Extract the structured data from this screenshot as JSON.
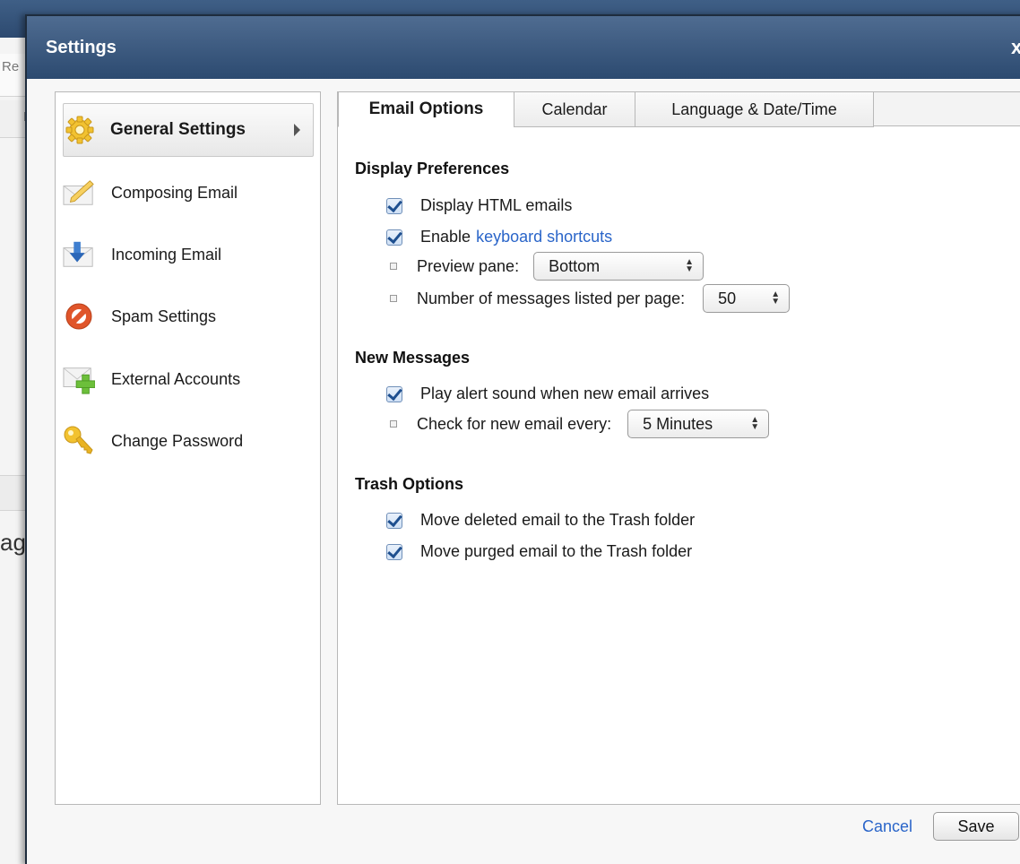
{
  "background": {
    "row1_text": "Re",
    "row2_text": "F",
    "row4_text": "ag"
  },
  "modal": {
    "title": "Settings",
    "close_label": "x"
  },
  "sidebar": {
    "items": [
      {
        "label": "General Settings",
        "icon": "gear-icon"
      },
      {
        "label": "Composing Email",
        "icon": "pencil-icon"
      },
      {
        "label": "Incoming Email",
        "icon": "download-arrow-icon"
      },
      {
        "label": "Spam Settings",
        "icon": "prohibited-icon"
      },
      {
        "label": "External Accounts",
        "icon": "envelope-plus-icon"
      },
      {
        "label": "Change Password",
        "icon": "key-icon"
      }
    ]
  },
  "tabs": [
    {
      "label": "Email Options"
    },
    {
      "label": "Calendar"
    },
    {
      "label": "Language & Date/Time"
    }
  ],
  "display_preferences": {
    "title": "Display Preferences",
    "display_html": "Display HTML emails",
    "enable_prefix": "Enable",
    "keyboard_shortcuts_link": "keyboard shortcuts",
    "preview_pane_label": "Preview pane:",
    "preview_pane_value": "Bottom",
    "messages_per_page_label": "Number of messages listed per page:",
    "messages_per_page_value": "50"
  },
  "new_messages": {
    "title": "New Messages",
    "play_alert": "Play alert sound when new email arrives",
    "check_label": "Check for new email every:",
    "check_value": "5 Minutes"
  },
  "trash_options": {
    "title": "Trash Options",
    "move_deleted": "Move deleted email to the Trash folder",
    "move_purged": "Move purged email to the Trash folder"
  },
  "footer": {
    "cancel_label": "Cancel",
    "save_label": "Save"
  },
  "colors": {
    "header": "#2c4a70",
    "link": "#2a65c9",
    "checkbox": "#1e4f8f"
  }
}
